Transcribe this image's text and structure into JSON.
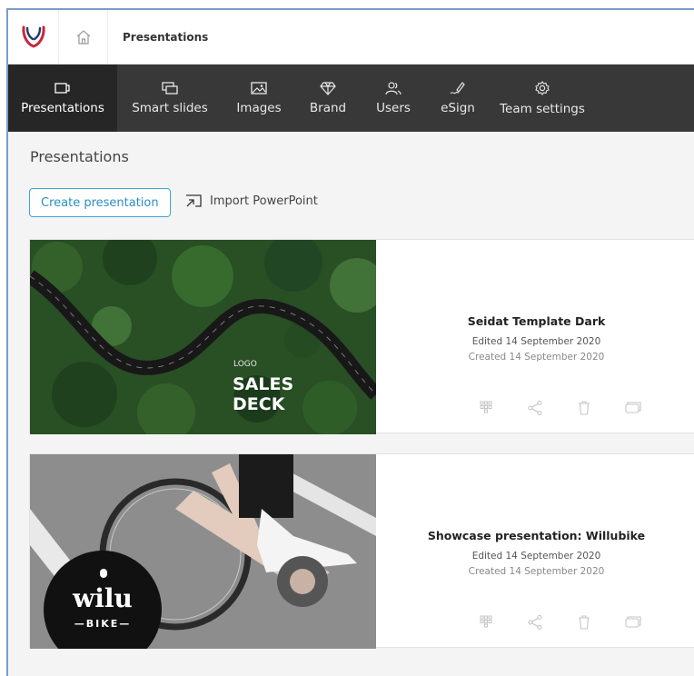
{
  "header": {
    "breadcrumb": "Presentations",
    "logo_icon": "antler-logo-icon",
    "home_icon": "home-icon",
    "brand_color": "#c8263a"
  },
  "nav": {
    "items": [
      {
        "label": "Presentations",
        "icon": "presentation-icon",
        "active": true
      },
      {
        "label": "Smart slides",
        "icon": "smart-slides-icon",
        "active": false
      },
      {
        "label": "Images",
        "icon": "image-icon",
        "active": false
      },
      {
        "label": "Brand",
        "icon": "diamond-icon",
        "active": false
      },
      {
        "label": "Users",
        "icon": "users-icon",
        "active": false
      },
      {
        "label": "eSign",
        "icon": "pen-icon",
        "active": false
      },
      {
        "label": "Team settings",
        "icon": "gear-icon",
        "active": false
      }
    ]
  },
  "main": {
    "title": "Presentations",
    "create_button": "Create presentation",
    "import_link": "Import PowerPoint",
    "accent_color": "#3aa6d6"
  },
  "presentations": [
    {
      "name": "Seidat Template Dark",
      "edited": "Edited 14 September 2020",
      "created": "Created 14 September 2020",
      "thumb_logo": "LOGO",
      "thumb_title_1": "SALES",
      "thumb_title_2": "DECK"
    },
    {
      "name": "Showcase presentation: Willubike",
      "edited": "Edited 14 September 2020",
      "created": "Created 14 September 2020",
      "thumb_brand": "wilu",
      "thumb_sub": "—BIKE—"
    }
  ]
}
